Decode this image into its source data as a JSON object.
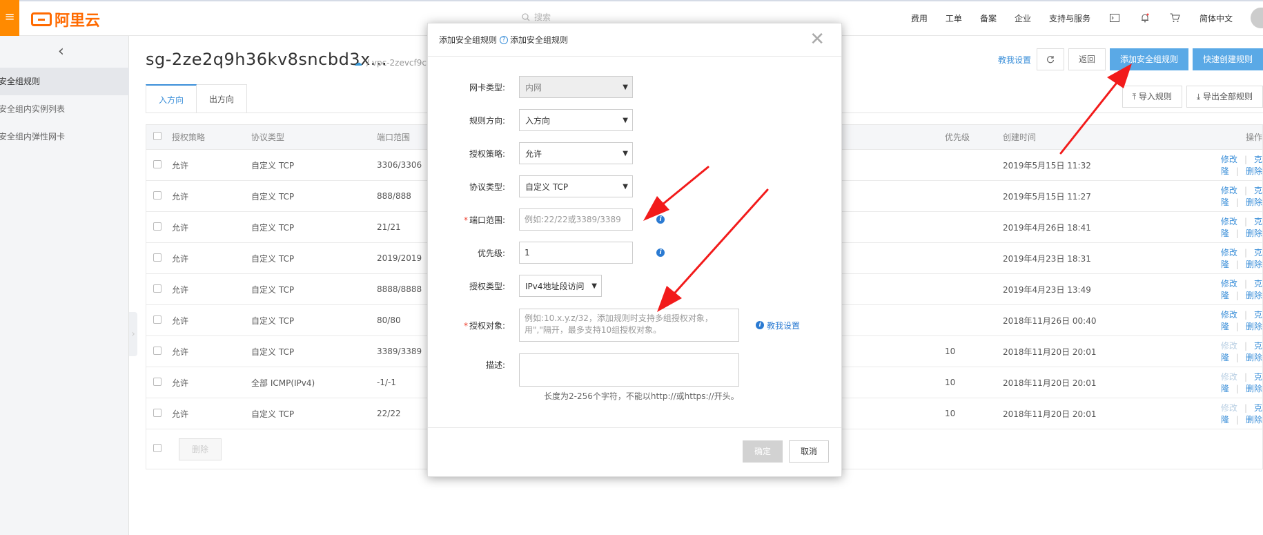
{
  "topbar": {
    "logo_text": "阿里云",
    "search_placeholder": "搜索",
    "nav": [
      "费用",
      "工单",
      "备案",
      "企业",
      "支持与服务"
    ],
    "language": "简体中文",
    "icons": [
      "terminal-icon",
      "bell-icon",
      "cart-icon"
    ]
  },
  "sidebar": {
    "items": [
      "安全组规则",
      "安全组内实例列表",
      "安全组内弹性网卡"
    ]
  },
  "header": {
    "title": "sg-2ze2q9h36kv8sncbd3x...",
    "vpc": "/ vpc-2zevcf9cu",
    "teach_link": "教我设置",
    "back_label": "返回",
    "add_rule_label": "添加安全组规则",
    "quick_create_label": "快速创建规则"
  },
  "tabs": [
    "入方向",
    "出方向"
  ],
  "toolbar": {
    "import_label": "导入规则",
    "export_label": "导出全部规则"
  },
  "table": {
    "headers": {
      "policy": "授权策略",
      "protocol": "协议类型",
      "port": "端口范围",
      "priority": "优先级",
      "created": "创建时间",
      "ops": "操作"
    },
    "ops_labels": {
      "edit": "修改",
      "clone": "克隆",
      "delete": "删除"
    },
    "rows": [
      {
        "policy": "允许",
        "protocol": "自定义 TCP",
        "port": "3306/3306",
        "priority": "",
        "created": "2019年5月15日 11:32",
        "edit_enabled": true
      },
      {
        "policy": "允许",
        "protocol": "自定义 TCP",
        "port": "888/888",
        "priority": "",
        "created": "2019年5月15日 11:27",
        "edit_enabled": true
      },
      {
        "policy": "允许",
        "protocol": "自定义 TCP",
        "port": "21/21",
        "priority": "",
        "created": "2019年4月26日 18:41",
        "edit_enabled": true
      },
      {
        "policy": "允许",
        "protocol": "自定义 TCP",
        "port": "2019/2019",
        "priority": "",
        "created": "2019年4月23日 18:31",
        "edit_enabled": true
      },
      {
        "policy": "允许",
        "protocol": "自定义 TCP",
        "port": "8888/8888",
        "priority": "",
        "created": "2019年4月23日 13:49",
        "edit_enabled": true
      },
      {
        "policy": "允许",
        "protocol": "自定义 TCP",
        "port": "80/80",
        "priority": "",
        "created": "2018年11月26日 00:40",
        "edit_enabled": true
      },
      {
        "policy": "允许",
        "protocol": "自定义 TCP",
        "port": "3389/3389",
        "priority": "10",
        "created": "2018年11月20日 20:01",
        "edit_enabled": false
      },
      {
        "policy": "允许",
        "protocol": "全部 ICMP(IPv4)",
        "port": "-1/-1",
        "priority": "10",
        "created": "2018年11月20日 20:01",
        "edit_enabled": false
      },
      {
        "policy": "允许",
        "protocol": "自定义 TCP",
        "port": "22/22",
        "priority": "10",
        "created": "2018年11月20日 20:01",
        "edit_enabled": false
      }
    ],
    "delete_button": "删除"
  },
  "dialog": {
    "title": "添加安全组规则",
    "help_text": "添加安全组规则",
    "fields": {
      "nic_type_label": "网卡类型:",
      "nic_type_value": "内网",
      "direction_label": "规则方向:",
      "direction_value": "入方向",
      "policy_label": "授权策略:",
      "policy_value": "允许",
      "protocol_label": "协议类型:",
      "protocol_value": "自定义 TCP",
      "port_label": "端口范围:",
      "port_placeholder": "例如:22/22或3389/3389",
      "priority_label": "优先级:",
      "priority_value": "1",
      "auth_type_label": "授权类型:",
      "auth_type_value": "IPv4地址段访问",
      "auth_object_label": "授权对象:",
      "auth_object_placeholder": "例如:10.x.y.z/32，添加规则时支持多组授权对象，用\",\"隔开，最多支持10组授权对象。",
      "teach_link": "教我设置",
      "desc_label": "描述:",
      "desc_hint": "长度为2-256个字符，不能以http://或https://开头。"
    },
    "ok_label": "确定",
    "cancel_label": "取消"
  },
  "colors": {
    "brand": "#ff6a00",
    "link": "#3b8fd9",
    "primary_button": "#5aa9e6",
    "annotation_arrow": "#f21b1b"
  }
}
